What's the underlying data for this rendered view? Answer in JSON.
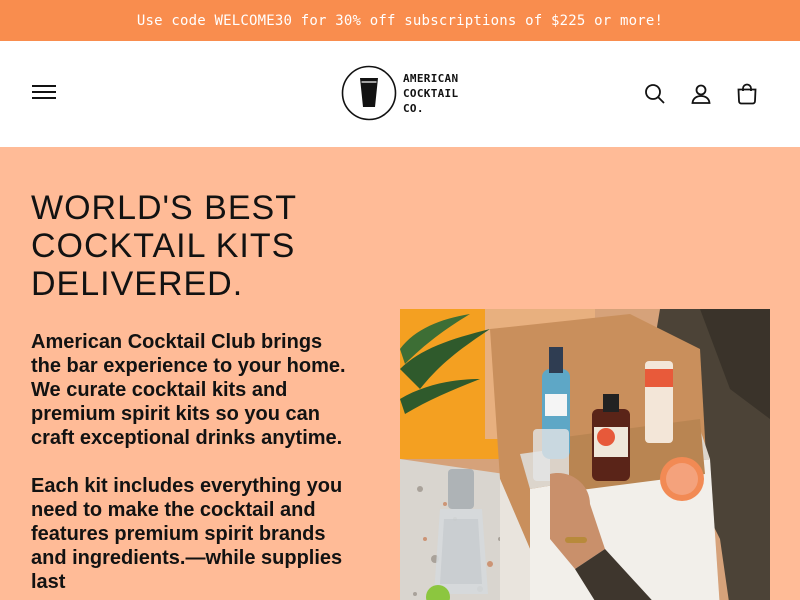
{
  "announcement": {
    "text": "Use code WELCOME30 for 30% off subscriptions of $225 or more!"
  },
  "header": {
    "logo": {
      "line1": "AMERICAN",
      "line2": "COCKTAIL",
      "line3": "CO."
    },
    "icons": [
      "menu-icon",
      "search-icon",
      "account-icon",
      "cart-icon"
    ]
  },
  "hero": {
    "title_line1": "WORLD'S BEST",
    "title_line2": "COCKTAIL KITS",
    "title_line3": "DELIVERED.",
    "paragraph1": "American Cocktail Club brings the bar experience to your home. We curate cocktail kits and premium spirit kits so you can craft exceptional drinks anytime.",
    "paragraph2": "Each kit includes everything you need to make the cocktail and features premium spirit brands and ingredients.—while supplies last"
  },
  "colors": {
    "announcement_bg": "#f98d4e",
    "hero_bg": "#ffbb97",
    "text": "#121212"
  }
}
